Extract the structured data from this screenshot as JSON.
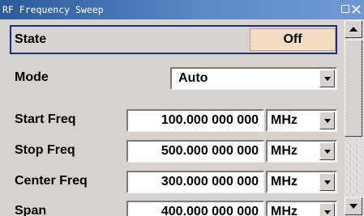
{
  "window": {
    "title": "RF Frequency Sweep"
  },
  "state": {
    "label": "State",
    "value": "Off"
  },
  "mode": {
    "label": "Mode",
    "value": "Auto"
  },
  "rows": [
    {
      "label": "Start Freq",
      "value": "100.000 000 000",
      "unit": "MHz"
    },
    {
      "label": "Stop Freq",
      "value": "500.000 000 000",
      "unit": "MHz"
    },
    {
      "label": "Center Freq",
      "value": "300.000 000 000",
      "unit": "MHz"
    },
    {
      "label": "Span",
      "value": "400.000 000 000",
      "unit": "MHz"
    }
  ],
  "icons": {
    "restore": "restore-icon",
    "close": "close-icon",
    "dropdown": "chevron-down-icon",
    "scroll_up": "arrow-up-icon",
    "scroll_down": "arrow-down-icon"
  },
  "colors": {
    "title_bar": "#2b5a9c",
    "state_button": "#f3ddc1",
    "focus_border": "#1b2a8f",
    "panel": "#d6d3ce"
  }
}
